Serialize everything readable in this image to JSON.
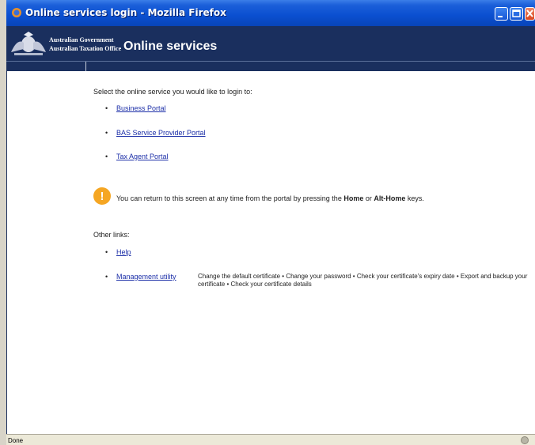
{
  "window": {
    "title": "Online services login - Mozilla Firefox"
  },
  "header": {
    "gov_line1": "Australian Government",
    "gov_line2": "Australian Taxation Office",
    "title": "Online services"
  },
  "main": {
    "intro": "Select the online service you would like to login to:",
    "services": [
      {
        "label": "Business Portal"
      },
      {
        "label": "BAS Service Provider Portal"
      },
      {
        "label": "Tax Agent Portal"
      }
    ],
    "notice": {
      "pre": "You can return to this screen at any time from the portal by pressing the ",
      "key1": "Home",
      "mid": " or ",
      "key2": "Alt-Home",
      "post": " keys."
    },
    "other_links_label": "Other links:",
    "other_links": [
      {
        "label": "Help"
      },
      {
        "label": "Management utility",
        "description": "Change the default certificate • Change your password • Check your certificate's expiry date • Export and backup your certificate • Check your certificate details"
      }
    ]
  },
  "statusbar": {
    "text": "Done"
  },
  "colors": {
    "header_bg": "#1a2f5e",
    "link": "#1c2fa8",
    "warning": "#f5a623"
  }
}
